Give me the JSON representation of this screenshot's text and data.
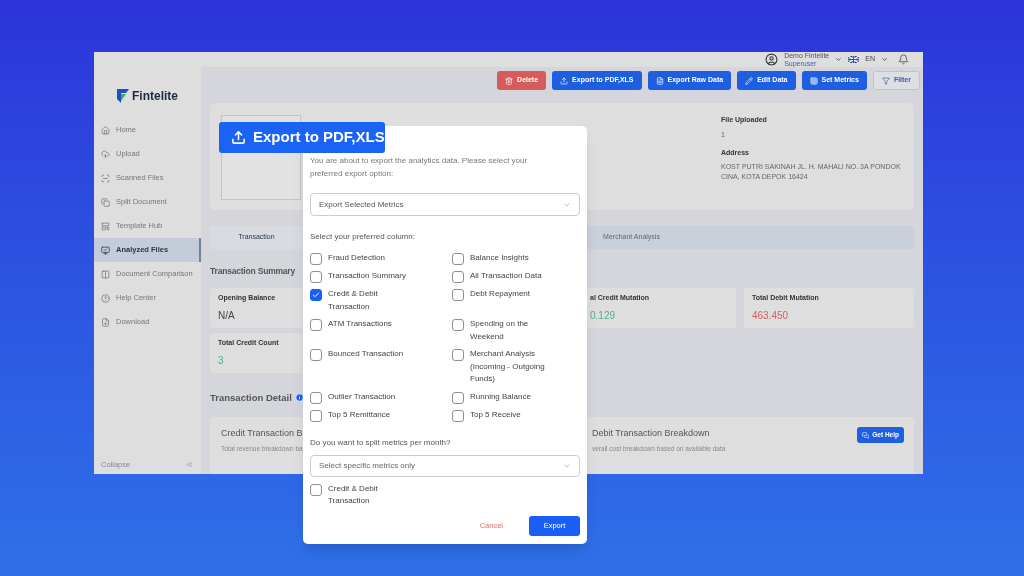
{
  "app": {
    "logo": "Fintelite",
    "user": {
      "name": "Demo Fintelite",
      "role": "Superuser"
    },
    "language": "EN",
    "sidebar": {
      "items": [
        {
          "label": "Home",
          "selected": false
        },
        {
          "label": "Upload",
          "selected": false
        },
        {
          "label": "Scanned Files",
          "selected": false
        },
        {
          "label": "Split Document",
          "selected": false
        },
        {
          "label": "Template Hub",
          "selected": false
        },
        {
          "label": "Analyzed Files",
          "selected": true
        },
        {
          "label": "Document Comparison",
          "selected": false
        },
        {
          "label": "Help Center",
          "selected": false
        },
        {
          "label": "Download",
          "selected": false
        }
      ],
      "collapse": "Collapse"
    },
    "toolbar": [
      {
        "label": "Delete",
        "kind": "danger"
      },
      {
        "label": "Export to PDF,XLS",
        "kind": "primary"
      },
      {
        "label": "Export Raw Data",
        "kind": "primary"
      },
      {
        "label": "Edit Data",
        "kind": "primary"
      },
      {
        "label": "Set Metrics",
        "kind": "primary"
      },
      {
        "label": "Filter",
        "kind": "outline"
      }
    ],
    "info": [
      {
        "label": "File Uploaded",
        "value": "1"
      },
      {
        "label": "Address",
        "value": "KOST PUTRI SAKINAH JL. H. MAHALI NO. 3A PONDOK CINA, KOTA DEPOK 16424"
      }
    ],
    "tabs": [
      {
        "label": "Transaction",
        "selected": true
      },
      {
        "label": "Merchant Analysis",
        "selected": false
      }
    ],
    "summary_title": "Transaction Summary",
    "cards": [
      {
        "label": "Opening Balance",
        "value": "N/A",
        "kind": "neutral"
      },
      {
        "label": "al Credit Mutation",
        "value": "0.129",
        "kind": "credit"
      },
      {
        "label": "Total Debit Mutation",
        "value": "463.450",
        "kind": "debit"
      },
      {
        "label": "Total Credit Count",
        "value": "3",
        "kind": "credit"
      }
    ],
    "detail_title": "Transaction Detail",
    "breakdowns": [
      {
        "title": "Credit Transaction B",
        "subtitle": "Total revenue breakdown ba"
      },
      {
        "title": "Debit Transaction Breakdown",
        "subtitle": "verall cost breakdown based on available data"
      }
    ],
    "help_button": "Get Help"
  },
  "badge": "Export to PDF,XLS",
  "dialog": {
    "intro": "You are about to export the analytics data. Please select your preferred export option:",
    "export_option": "Export Selected Metrics",
    "columns_label": "Select your preferred column:",
    "columns": [
      {
        "label": "Fraud Detection",
        "checked": false
      },
      {
        "label": "Balance Insights",
        "checked": false
      },
      {
        "label": "Transaction Summary",
        "checked": false
      },
      {
        "label": "All Transaction Data",
        "checked": false
      },
      {
        "label": "Credit & Debit Transaction",
        "checked": true
      },
      {
        "label": "Debt Repayment",
        "checked": false
      },
      {
        "label": "ATM Transactions",
        "checked": false
      },
      {
        "label": "Spending on the Weekend",
        "checked": false
      },
      {
        "label": "Bounced Transaction",
        "checked": false
      },
      {
        "label": "Merchant Analysis (Incoming - Outgoing Funds)",
        "checked": false
      },
      {
        "label": "Outlier Transaction",
        "checked": false
      },
      {
        "label": "Running Balance",
        "checked": false
      },
      {
        "label": "Top 5 Remittance",
        "checked": false
      },
      {
        "label": "Top 5 Receive",
        "checked": false
      }
    ],
    "split_label": "Do you want to split metrics per month?",
    "split_placeholder": "Select specific metrics only",
    "split_options": [
      {
        "label": "Credit & Debit Transaction",
        "checked": false
      }
    ],
    "cancel": "Cancel",
    "export": "Export"
  }
}
